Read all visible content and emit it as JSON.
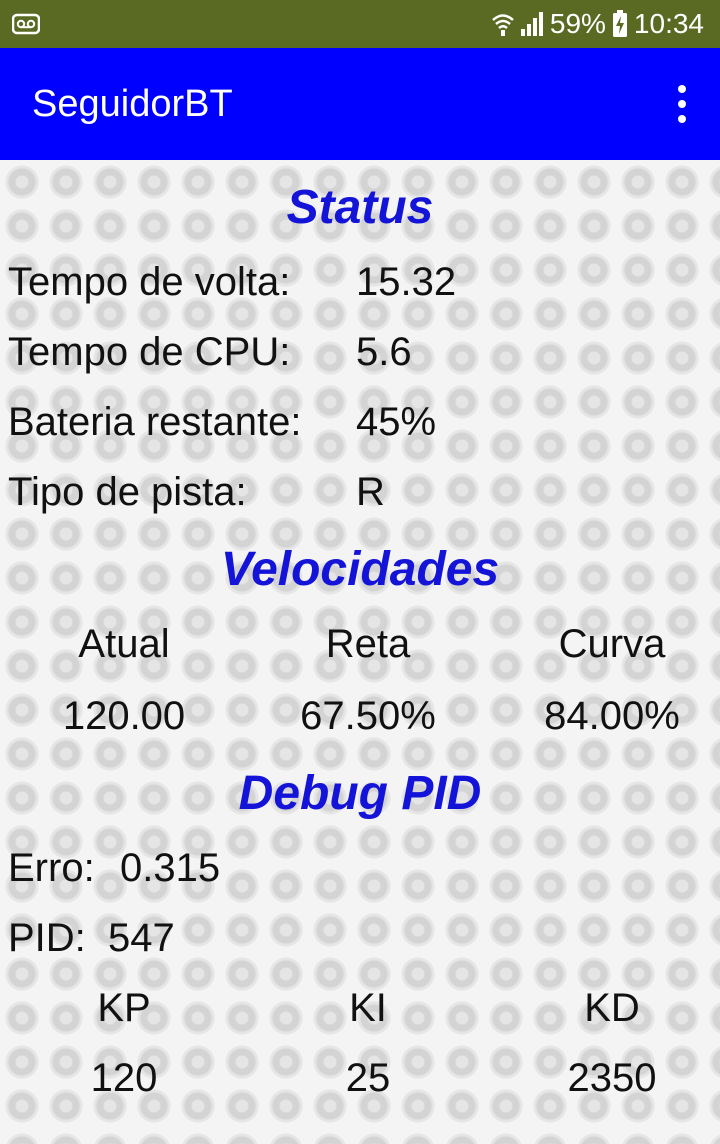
{
  "status_bar": {
    "battery_percent": "59%",
    "time": "10:34",
    "icons": [
      "voicemail-icon",
      "wifi-icon",
      "signal-icon",
      "battery-charging-icon"
    ]
  },
  "app_bar": {
    "title": "SeguidorBT",
    "menu_icon": "overflow-menu-icon"
  },
  "status": {
    "title": "Status",
    "rows": [
      {
        "label": "Tempo de volta:",
        "value": "15.32"
      },
      {
        "label": "Tempo de CPU:",
        "value": "5.6"
      },
      {
        "label": "Bateria restante:",
        "value": "45%"
      },
      {
        "label": "Tipo de pista:",
        "value": "R"
      }
    ]
  },
  "velocidades": {
    "title": "Velocidades",
    "columns": [
      {
        "label": "Atual",
        "value": "120.00"
      },
      {
        "label": "Reta",
        "value": "67.50%"
      },
      {
        "label": "Curva",
        "value": "84.00%"
      }
    ]
  },
  "debug_pid": {
    "title": "Debug PID",
    "erro_label": "Erro:",
    "erro_value": "0.315",
    "pid_label": "PID:",
    "pid_value": "547",
    "columns": [
      {
        "label": "KP",
        "value": "120"
      },
      {
        "label": "KI",
        "value": "25"
      },
      {
        "label": "KD",
        "value": "2350"
      }
    ]
  },
  "colors": {
    "status_bar": "#5a6a23",
    "app_bar": "#0000ff",
    "section_title": "#1414d8"
  }
}
